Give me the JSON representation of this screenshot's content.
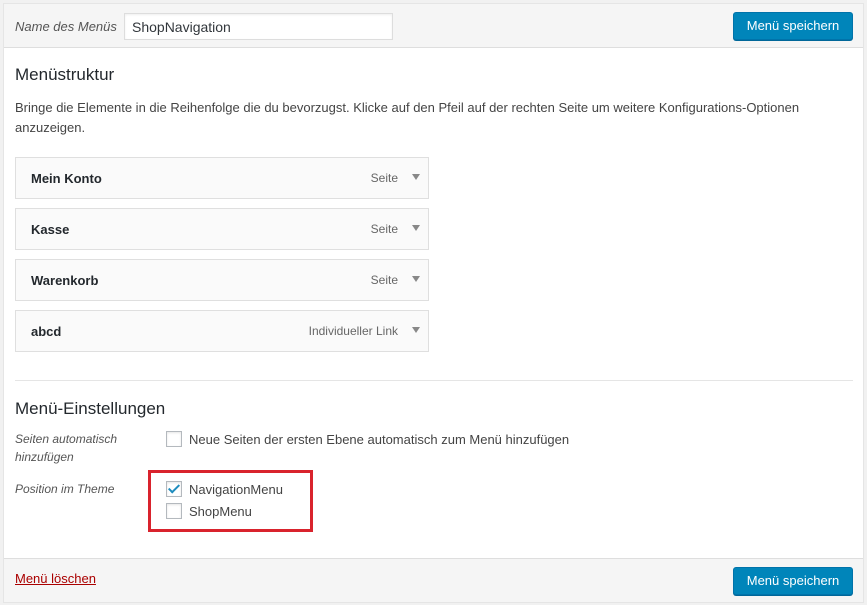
{
  "header": {
    "name_label": "Name des Menüs",
    "name_value": "ShopNavigation",
    "save_label": "Menü speichern"
  },
  "structure": {
    "title": "Menüstruktur",
    "description": "Bringe die Elemente in die Reihenfolge die du bevorzugst. Klicke auf den Pfeil auf der rechten Seite um weitere Konfigurations-Optionen anzuzeigen.",
    "items": [
      {
        "title": "Mein Konto",
        "type": "Seite"
      },
      {
        "title": "Kasse",
        "type": "Seite"
      },
      {
        "title": "Warenkorb",
        "type": "Seite"
      },
      {
        "title": "abcd",
        "type": "Individueller Link"
      }
    ]
  },
  "settings": {
    "title": "Menü-Einstellungen",
    "auto_add_label": "Seiten automatisch hinzufügen",
    "auto_add_option": "Neue Seiten der ersten Ebene automatisch zum Menü hinzufügen",
    "auto_add_checked": false,
    "position_label": "Position im Theme",
    "locations": [
      {
        "label": "NavigationMenu",
        "checked": true
      },
      {
        "label": "ShopMenu",
        "checked": false
      }
    ],
    "highlight_color": "#d9232d"
  },
  "footer": {
    "delete_label": "Menü löschen",
    "save_label": "Menü speichern"
  },
  "colors": {
    "primary": "#0085ba",
    "delete": "#aa0000"
  }
}
